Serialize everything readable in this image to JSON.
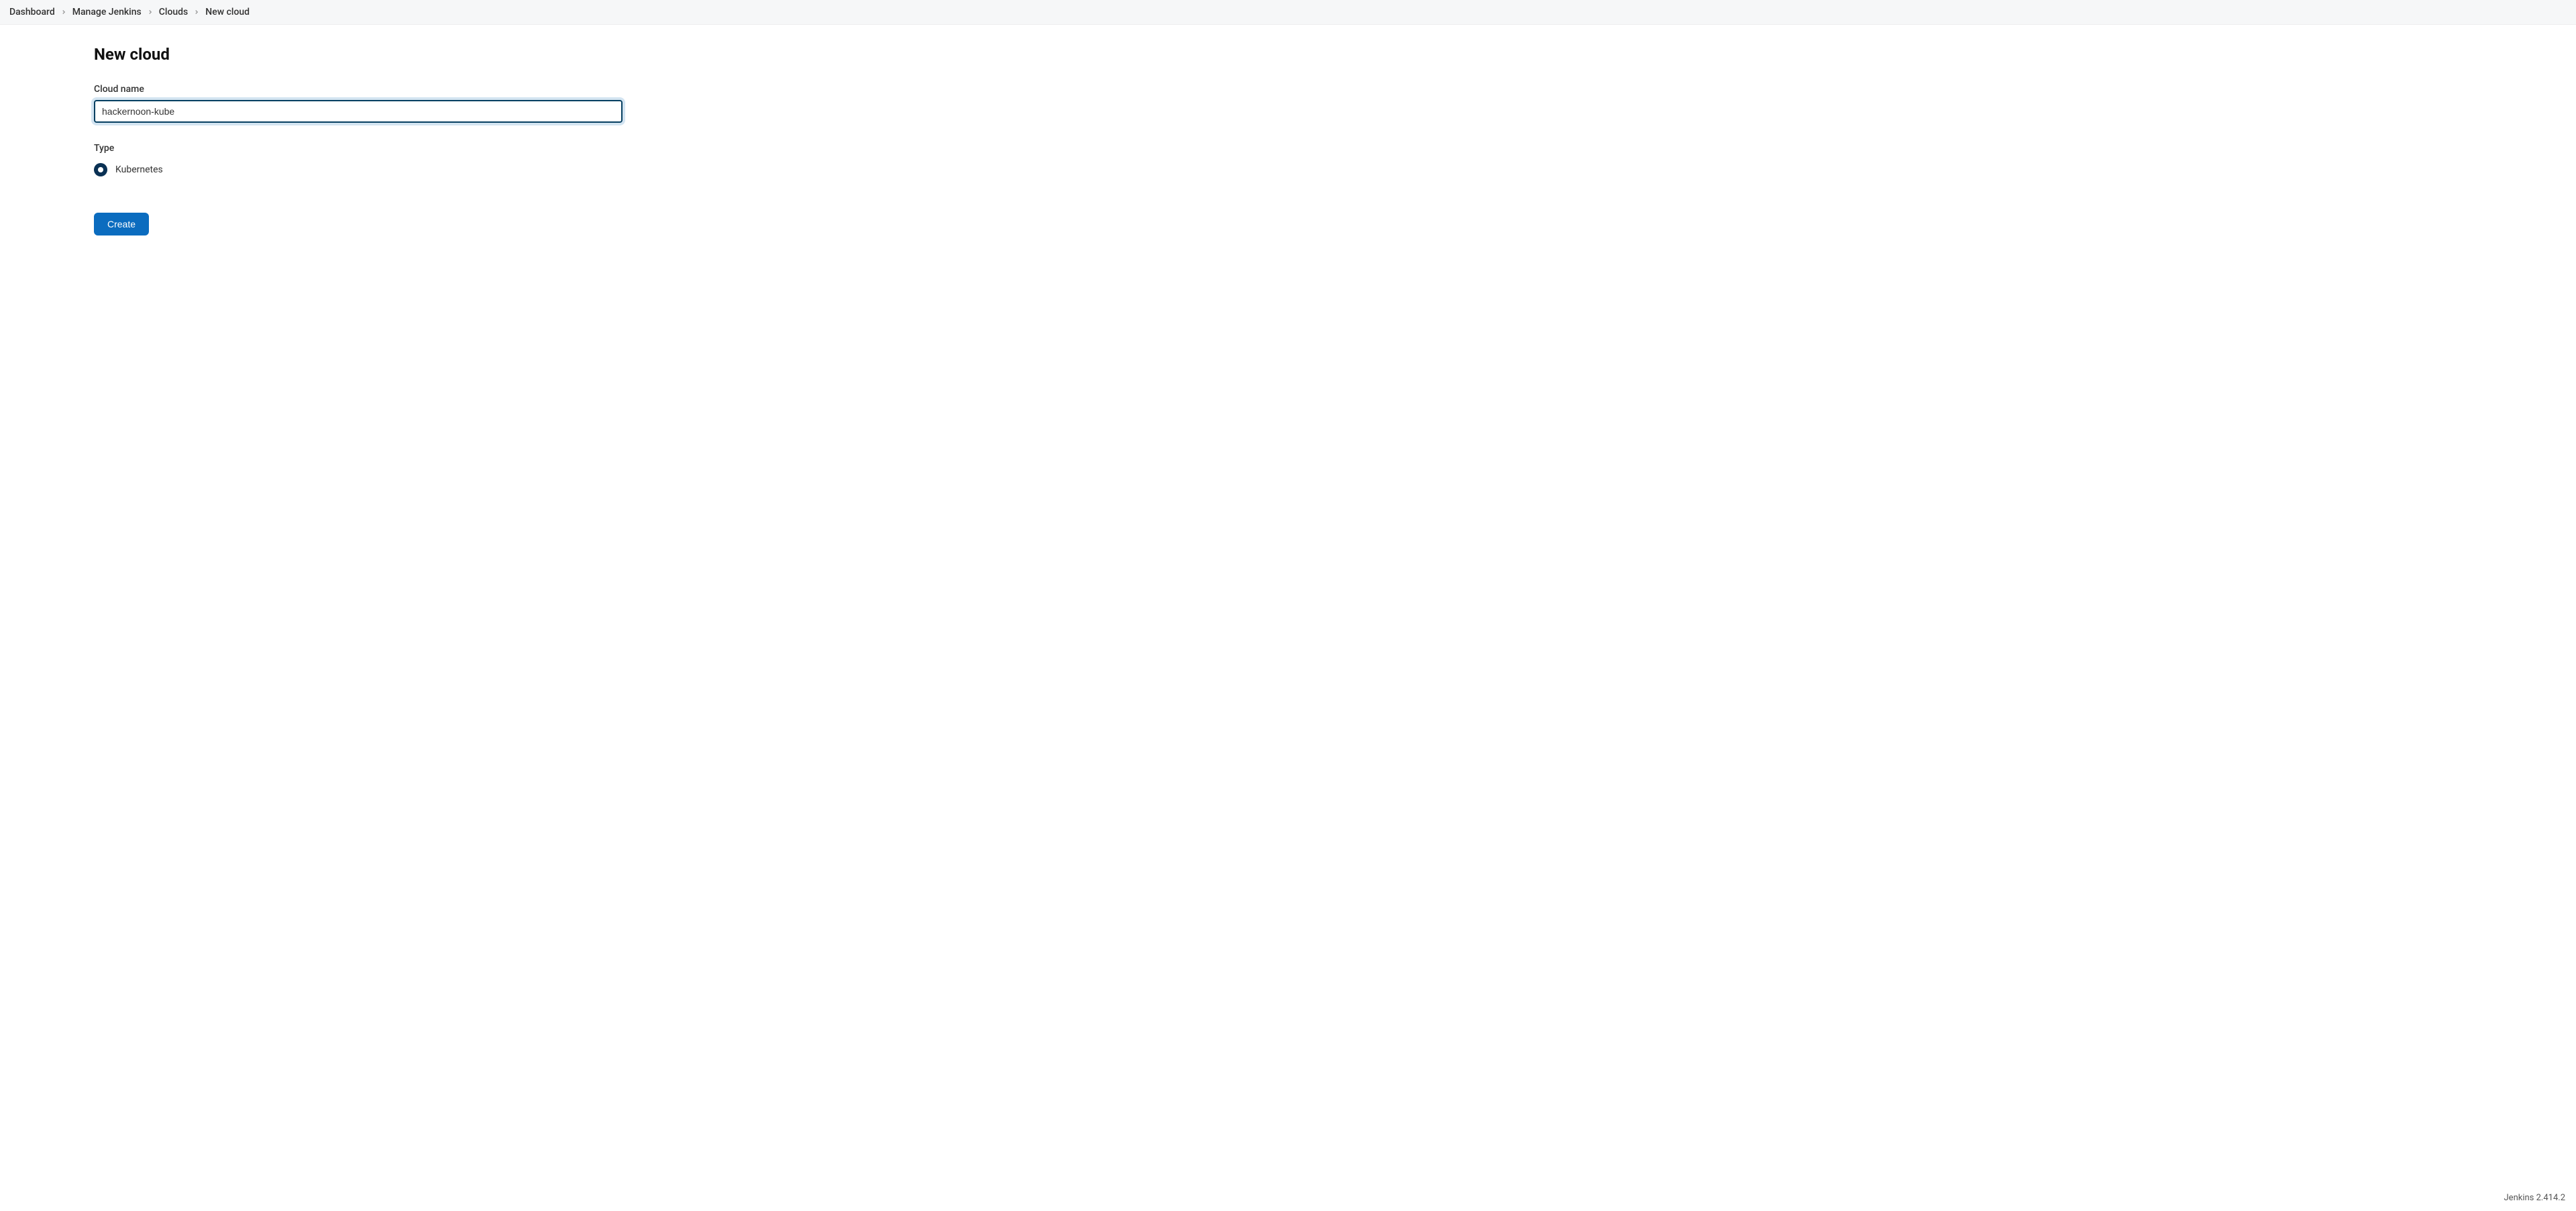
{
  "breadcrumbs": {
    "items": [
      {
        "label": "Dashboard"
      },
      {
        "label": "Manage Jenkins"
      },
      {
        "label": "Clouds"
      }
    ],
    "current": "New cloud"
  },
  "page": {
    "title": "New cloud"
  },
  "form": {
    "cloud_name": {
      "label": "Cloud name",
      "value": "hackernoon-kube"
    },
    "type": {
      "label": "Type",
      "options": [
        {
          "label": "Kubernetes",
          "selected": true
        }
      ]
    },
    "create_button": "Create"
  },
  "footer": {
    "version": "Jenkins 2.414.2"
  }
}
